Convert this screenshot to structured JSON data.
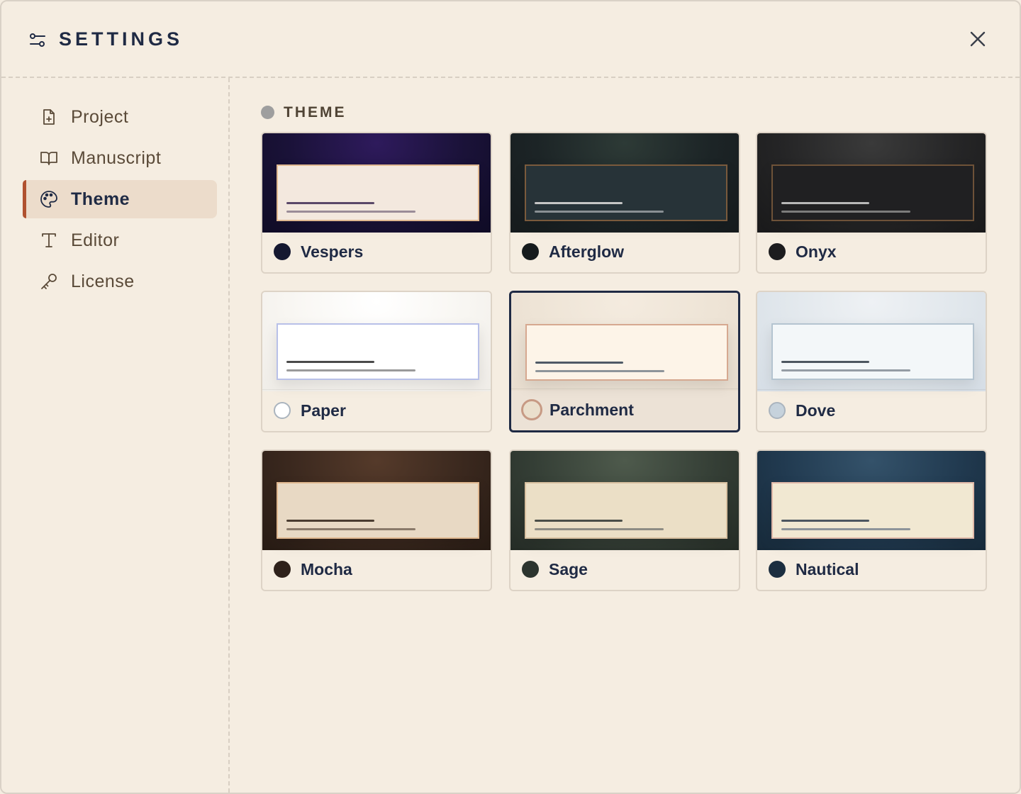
{
  "header": {
    "title": "SETTINGS"
  },
  "sidebar": {
    "items": [
      {
        "label": "Project",
        "icon": "file-plus-icon",
        "active": false
      },
      {
        "label": "Manuscript",
        "icon": "book-open-icon",
        "active": false
      },
      {
        "label": "Theme",
        "icon": "palette-icon",
        "active": true
      },
      {
        "label": "Editor",
        "icon": "type-icon",
        "active": false
      },
      {
        "label": "License",
        "icon": "key-icon",
        "active": false
      }
    ]
  },
  "section": {
    "label": "THEME"
  },
  "themes": [
    {
      "name": "Vespers",
      "selected": false,
      "swatch": "#151830",
      "bg": "radial-gradient(ellipse at 50% 10%, #2e1a5c 0%, #1a1238 55%, #100c26 100%)",
      "doc_bg": "#f3e8de",
      "doc_border": "#e0b890",
      "line1": "#5a4868",
      "line2": "#9a8c98"
    },
    {
      "name": "Afterglow",
      "selected": false,
      "swatch": "#161b1d",
      "bg": "radial-gradient(ellipse at 50% 10%, #2d3a36 0%, #1c2426 55%, #161b1d 100%)",
      "doc_bg": "#273338",
      "doc_border": "#7a5a3c",
      "line1": "#c6c6c6",
      "line2": "#8a9094"
    },
    {
      "name": "Onyx",
      "selected": false,
      "swatch": "#1c1c1e",
      "bg": "radial-gradient(ellipse at 50% 10%, #3a3a3a 0%, #252526 55%, #1a1a1b 100%)",
      "doc_bg": "#202022",
      "doc_border": "#6e5238",
      "line1": "#b8b8b8",
      "line2": "#7c7c7c"
    },
    {
      "name": "Paper",
      "selected": false,
      "swatch": "#ffffff",
      "bg": "radial-gradient(ellipse at 50% 10%, #ffffff 0%, #f8f6f2 55%, #f0ede8 100%)",
      "doc_bg": "#ffffff",
      "doc_border": "#b8c0e8",
      "line1": "#4a4a4a",
      "line2": "#9a9a9a"
    },
    {
      "name": "Parchment",
      "selected": true,
      "swatch": "#eadfcc",
      "bg": "radial-gradient(ellipse at 50% 10%, #f4ebdf 0%, #eee4d6 55%, #e8ddcf 100%)",
      "doc_bg": "#fdf4e8",
      "doc_border": "#d6a890",
      "line1": "#4f5a66",
      "line2": "#8e949a"
    },
    {
      "name": "Dove",
      "selected": false,
      "swatch": "#c6d2dc",
      "bg": "radial-gradient(ellipse at 50% 10%, #eef1f4 0%, #e1e7ec 55%, #d6dee6 100%)",
      "doc_bg": "#f3f7f9",
      "doc_border": "#b4c4d0",
      "line1": "#4c5660",
      "line2": "#949ca4"
    },
    {
      "name": "Mocha",
      "selected": false,
      "swatch": "#2e211a",
      "bg": "radial-gradient(ellipse at 50% 10%, #553a2a 0%, #3a281e 55%, #271b14 100%)",
      "doc_bg": "#e8d9c4",
      "doc_border": "#e0b890",
      "line1": "#4a3c30",
      "line2": "#8a7a6a"
    },
    {
      "name": "Sage",
      "selected": false,
      "swatch": "#2c342e",
      "bg": "radial-gradient(ellipse at 50% 10%, #4e5a4c 0%, #353f36 55%, #252c26 100%)",
      "doc_bg": "#ebdfc6",
      "doc_border": "#d8c0a0",
      "line1": "#4a4e48",
      "line2": "#8e8c84"
    },
    {
      "name": "Nautical",
      "selected": false,
      "swatch": "#1c2e40",
      "bg": "radial-gradient(ellipse at 50% 10%, #34526a 0%, #213a50 55%, #172a3a 100%)",
      "doc_bg": "#f1e8d2",
      "doc_border": "#e0b8a8",
      "line1": "#4c5660",
      "line2": "#8e949a"
    }
  ]
}
